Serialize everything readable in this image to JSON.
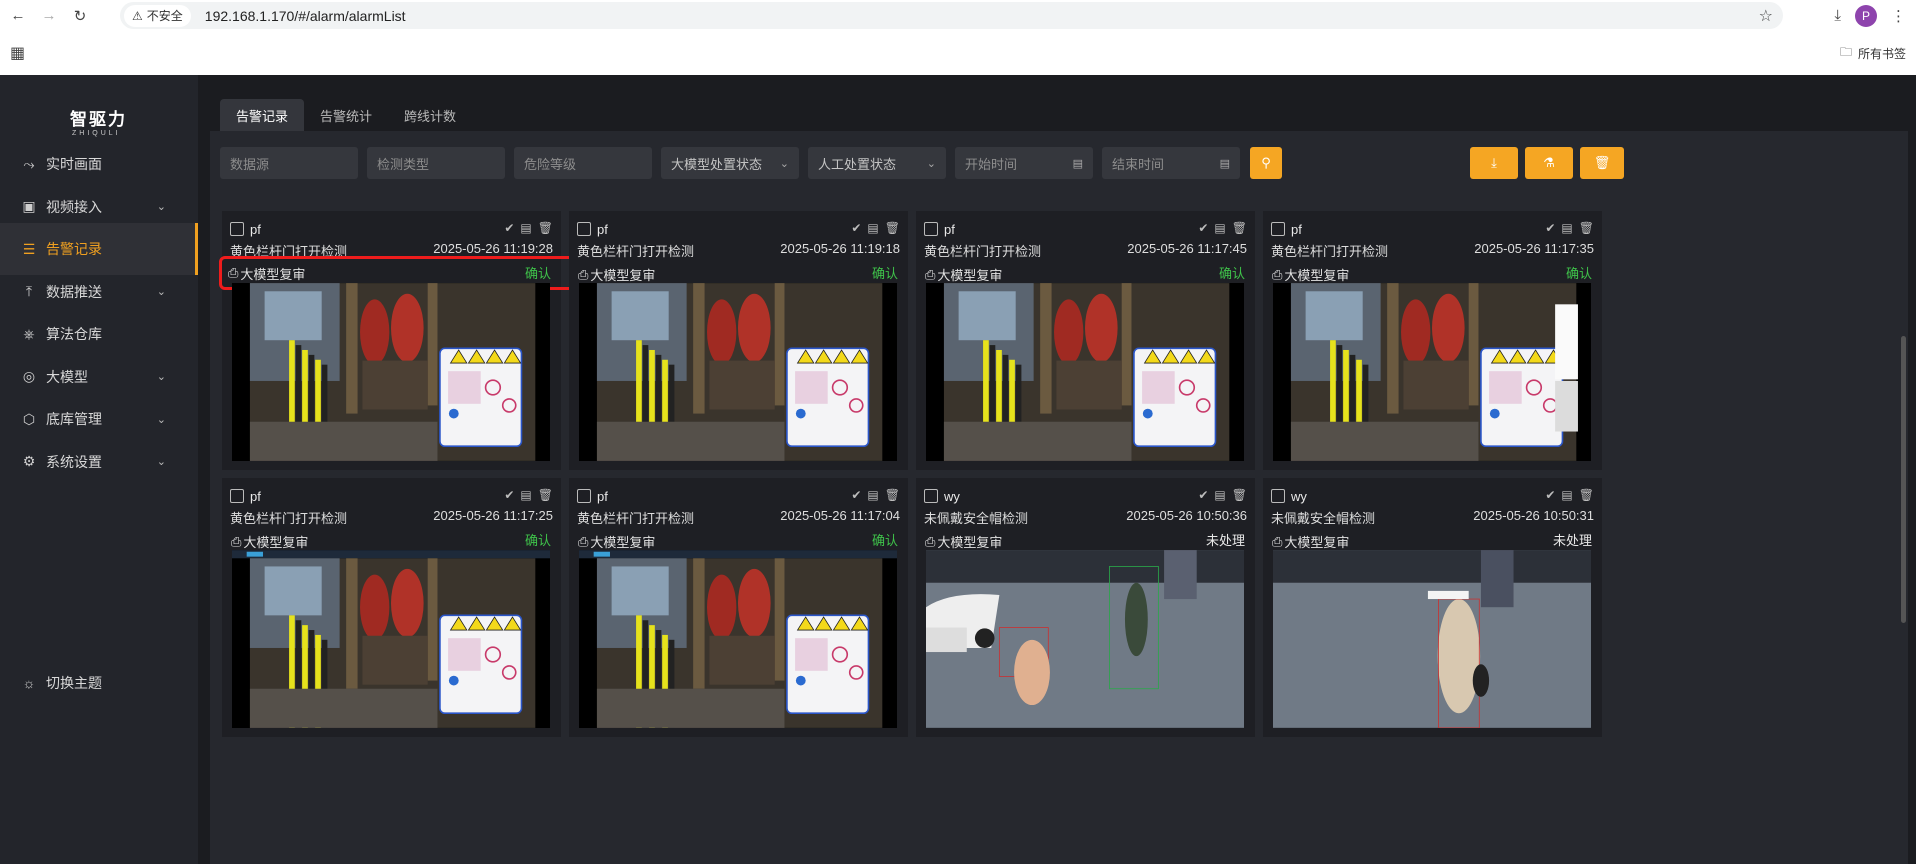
{
  "browser": {
    "security_label": "不安全",
    "url": "192.168.1.170/#/alarm/alarmList",
    "avatar_letter": "P",
    "bookmarks_label": "所有书签"
  },
  "app": {
    "logo": "智驱力",
    "logo_sub": "ZHIQULI"
  },
  "sidebar": {
    "items": [
      {
        "label": "实时画面",
        "icon": "chart-line-icon",
        "has_chevron": false
      },
      {
        "label": "视频接入",
        "icon": "monitor-icon",
        "has_chevron": true
      },
      {
        "label": "告警记录",
        "icon": "document-icon",
        "has_chevron": false,
        "active": true
      },
      {
        "label": "数据推送",
        "icon": "upload-icon",
        "has_chevron": true
      },
      {
        "label": "算法仓库",
        "icon": "cube-icon",
        "has_chevron": false
      },
      {
        "label": "大模型",
        "icon": "target-icon",
        "has_chevron": true
      },
      {
        "label": "底库管理",
        "icon": "box-icon",
        "has_chevron": true
      },
      {
        "label": "系统设置",
        "icon": "gear-icon",
        "has_chevron": true
      }
    ],
    "theme_toggle": "切换主题"
  },
  "tabs": [
    {
      "label": "告警记录",
      "active": true
    },
    {
      "label": "告警统计",
      "active": false
    },
    {
      "label": "跨线计数",
      "active": false
    }
  ],
  "filters": {
    "data_source": "数据源",
    "detect_type": "检测类型",
    "risk_level": "危险等级",
    "llm_status": "大模型处置状态",
    "manual_status": "人工处置状态",
    "start_time": "开始时间",
    "end_time": "结束时间"
  },
  "cards": [
    {
      "name": "pf",
      "title": "黄色栏杆门打开检测",
      "time": "2025-05-26 11:19:28",
      "tag": "大模型复审",
      "status": "确认",
      "status_type": "ok",
      "scene": "gate",
      "highlight": true
    },
    {
      "name": "pf",
      "title": "黄色栏杆门打开检测",
      "time": "2025-05-26 11:19:18",
      "tag": "大模型复审",
      "status": "确认",
      "status_type": "ok",
      "scene": "gate"
    },
    {
      "name": "pf",
      "title": "黄色栏杆门打开检测",
      "time": "2025-05-26 11:17:45",
      "tag": "大模型复审",
      "status": "确认",
      "status_type": "ok",
      "scene": "gate"
    },
    {
      "name": "pf",
      "title": "黄色栏杆门打开检测",
      "time": "2025-05-26 11:17:35",
      "tag": "大模型复审",
      "status": "确认",
      "status_type": "ok",
      "scene": "gate-overlay"
    },
    {
      "name": "pf",
      "title": "黄色栏杆门打开检测",
      "time": "2025-05-26 11:17:25",
      "tag": "大模型复审",
      "status": "确认",
      "status_type": "ok",
      "scene": "gate-screen"
    },
    {
      "name": "pf",
      "title": "黄色栏杆门打开检测",
      "time": "2025-05-26 11:17:04",
      "tag": "大模型复审",
      "status": "确认",
      "status_type": "ok",
      "scene": "gate-screen"
    },
    {
      "name": "wy",
      "title": "未佩戴安全帽检测",
      "time": "2025-05-26 10:50:36",
      "tag": "大模型复审",
      "status": "未处理",
      "status_type": "pend",
      "scene": "street"
    },
    {
      "name": "wy",
      "title": "未佩戴安全帽检测",
      "time": "2025-05-26 10:50:31",
      "tag": "大模型复审",
      "status": "未处理",
      "status_type": "pend",
      "scene": "street2"
    }
  ]
}
